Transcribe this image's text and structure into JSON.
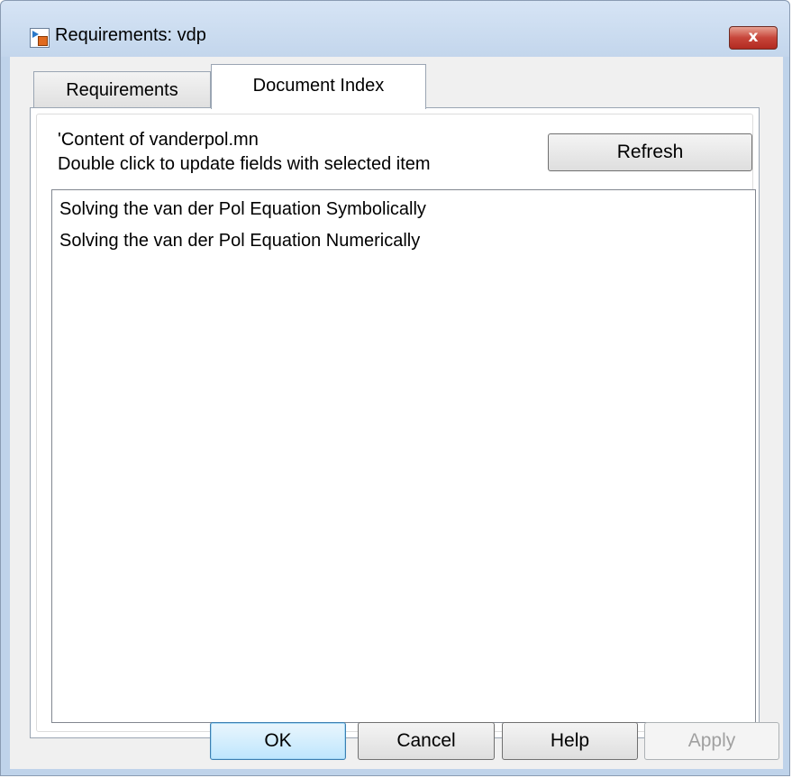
{
  "window": {
    "title": "Requirements: vdp",
    "close_glyph": "x",
    "icon": "simulink-model-icon"
  },
  "tabs": [
    {
      "label": "Requirements",
      "selected": false
    },
    {
      "label": "Document Index",
      "selected": true
    }
  ],
  "document_index": {
    "content_label": "'Content of vanderpol.mn",
    "hint": "Double click to update fields with selected item",
    "refresh_label": "Refresh",
    "items": [
      "Solving the van der Pol Equation Symbolically",
      "Solving the van der Pol Equation Numerically"
    ]
  },
  "buttons": {
    "ok": "OK",
    "cancel": "Cancel",
    "help": "Help",
    "apply": "Apply"
  },
  "colors": {
    "close_button": "#c7453a",
    "ok_default_border": "#3c7fb1"
  }
}
